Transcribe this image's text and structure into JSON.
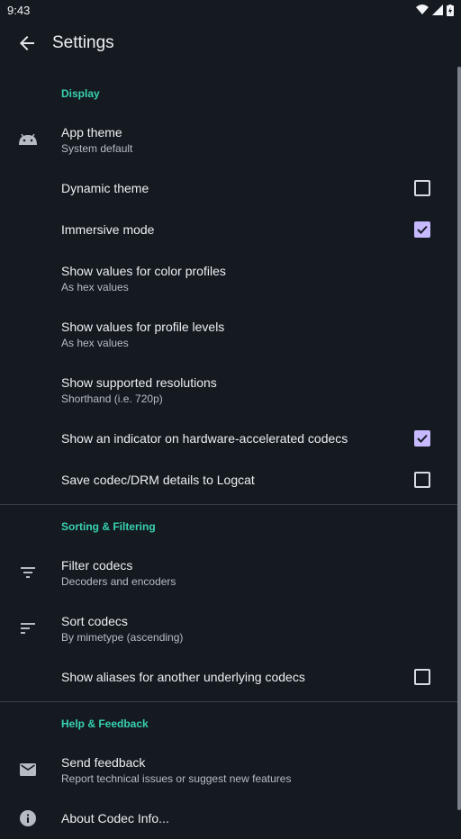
{
  "status": {
    "time": "9:43"
  },
  "header": {
    "title": "Settings"
  },
  "sections": {
    "display": "Display",
    "sorting": "Sorting & Filtering",
    "help": "Help & Feedback"
  },
  "display": {
    "app_theme": {
      "title": "App theme",
      "summary": "System default"
    },
    "dynamic_theme": {
      "title": "Dynamic theme",
      "checked": false
    },
    "immersive": {
      "title": "Immersive mode",
      "checked": true
    },
    "color_profiles": {
      "title": "Show values for color profiles",
      "summary": "As hex values"
    },
    "profile_levels": {
      "title": "Show values for profile levels",
      "summary": "As hex values"
    },
    "resolutions": {
      "title": "Show supported resolutions",
      "summary": "Shorthand (i.e. 720p)"
    },
    "hw_indicator": {
      "title": "Show an indicator on hardware-accelerated codecs",
      "checked": true
    },
    "logcat": {
      "title": "Save codec/DRM details to Logcat",
      "checked": false
    }
  },
  "sorting": {
    "filter": {
      "title": "Filter codecs",
      "summary": "Decoders and encoders"
    },
    "sort": {
      "title": "Sort codecs",
      "summary": "By mimetype (ascending)"
    },
    "aliases": {
      "title": "Show aliases for another underlying codecs",
      "checked": false
    }
  },
  "help": {
    "feedback": {
      "title": "Send feedback",
      "summary": "Report technical issues or suggest new features"
    },
    "about": {
      "title": "About Codec Info..."
    }
  },
  "colors": {
    "accent": "#38d1b0",
    "checkbox": "#c6b9ff",
    "background": "#151a21"
  },
  "icons": [
    "android-icon",
    "filter-icon",
    "sort-icon",
    "mail-icon",
    "info-icon",
    "arrow-back-icon"
  ]
}
